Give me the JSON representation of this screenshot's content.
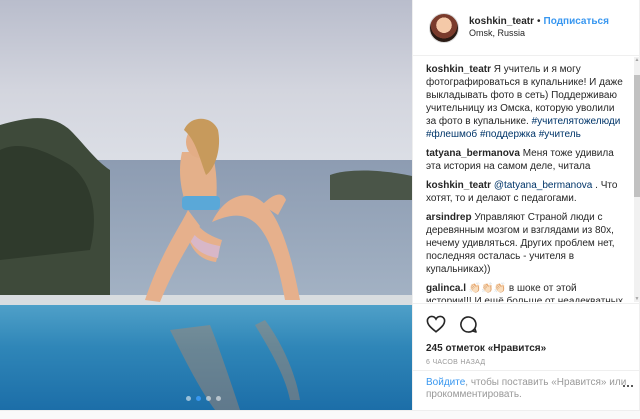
{
  "post": {
    "username": "koshkin_teatr",
    "separator": "•",
    "follow_label": "Подписаться",
    "location": "Omsk, Russia"
  },
  "media": {
    "slide_count": 4,
    "active_slide": 2
  },
  "caption": {
    "author": "koshkin_teatr",
    "text": " Я учитель и я могу фотографироваться в купальнике! И даже выкладывать фото в сеть) Поддерживаю учительницу из Омска, которую уволили за фото в купальнике. ",
    "tag1": "#учителятожелюди",
    "tag2": "#флешмоб",
    "tag3": "#поддержка",
    "tag4": "#учитель"
  },
  "comments": [
    {
      "author": "tatyana_bermanova",
      "text": " Меня тоже удивила эта история на самом деле, читала"
    },
    {
      "author": "koshkin_teatr",
      "mention": "@tatyana_bermanova",
      "text": " . Что хотят, то и делают с педагогами."
    },
    {
      "author": "arsindrep",
      "text": " Управляют Страной люди с деревянным мозгом и взглядами из 80х, нечему удивляться. Других проблем нет, последняя осталась - учителя в купальниках))"
    },
    {
      "author": "galinca.l",
      "text": " 👏🏻👏🏻👏🏻 в шоке от этой истории!!! И ещё больше от неадекватных"
    }
  ],
  "icons": {
    "like": "heart-icon",
    "comment": "speech-bubble-icon",
    "more": "more-options-icon"
  },
  "stats": {
    "likes_text": "245 отметок «Нравится»",
    "time_text": "6 ЧАСОВ НАЗАД"
  },
  "login": {
    "link_text": "Войдите",
    "rest_text": ", чтобы поставить «Нравится» или прокомментировать."
  },
  "colors": {
    "accent": "#3897f0",
    "hashtag": "#003569",
    "muted": "#999999",
    "border": "#efefef"
  }
}
